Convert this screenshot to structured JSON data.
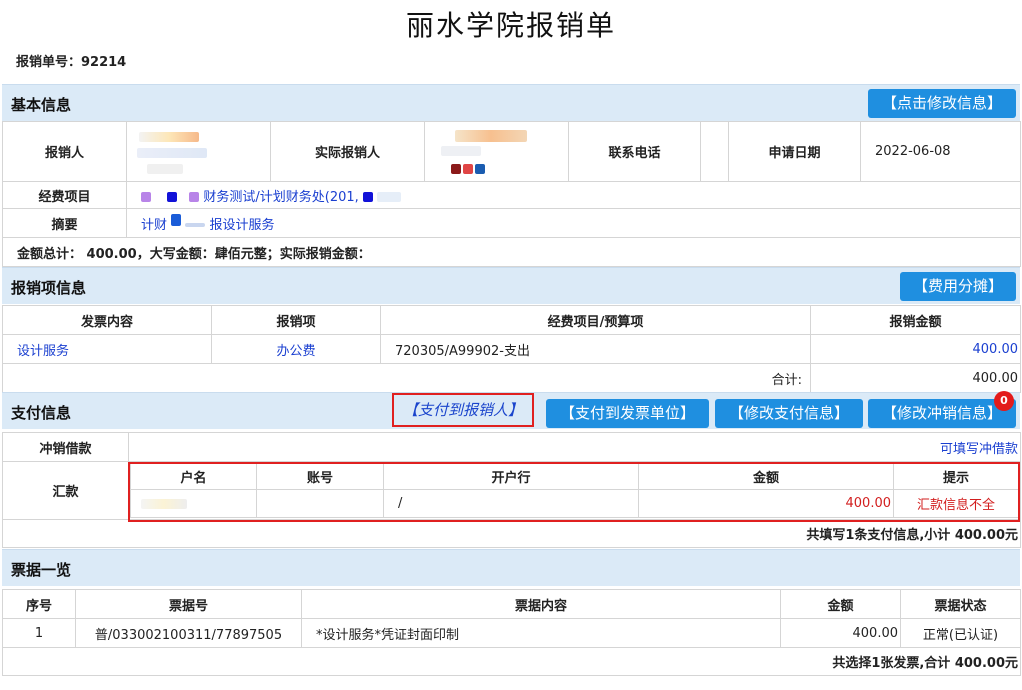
{
  "title": "丽水学院报销单",
  "doc_no": "报销单号：92214",
  "basic": {
    "section_title": "基本信息",
    "edit_button": "【点击修改信息】",
    "applicant_label": "报销人",
    "actual_label": "实际报销人",
    "phone_label": "联系电话",
    "date_label": "申请日期",
    "date_value": "2022-06-08",
    "project_label": "经费项目",
    "project_value": "财务测试/计划财务处(201,",
    "summary_label": "摘要",
    "summary_value_a": "计财",
    "summary_value_b": "报设计服务",
    "total_line": "金额总计： 400.00，大写金额：肆佰元整；实际报销金额："
  },
  "items": {
    "section_title": "报销项信息",
    "split_button": "【费用分摊】",
    "headers": [
      "发票内容",
      "报销项",
      "经费项目/预算项",
      "报销金额"
    ],
    "rows": [
      {
        "content": "设计服务",
        "item": "办公费",
        "budget": "720305/A99902-支出",
        "amount": "400.00"
      }
    ],
    "total_label": "合计:",
    "total_value": "400.00"
  },
  "payment": {
    "section_title": "支付信息",
    "pay_applicant": "【支付到报销人】",
    "pay_invoice_unit": "【支付到发票单位】",
    "edit_payment": "【修改支付信息】",
    "edit_offset": "【修改冲销信息】",
    "badge": "0",
    "offset_label": "冲销借款",
    "offset_link": "可填写冲借款",
    "remit_label": "汇款",
    "headers": [
      "户名",
      "账号",
      "开户行",
      "金额",
      "提示"
    ],
    "rows": [
      {
        "name": "",
        "account": "",
        "bank": "/",
        "amount": "400.00",
        "hint": "汇款信息不全"
      }
    ],
    "summary": "共填写1条支付信息,小计 400.00元"
  },
  "bills": {
    "section_title": "票据一览",
    "headers": [
      "序号",
      "票据号",
      "票据内容",
      "金额",
      "票据状态"
    ],
    "rows": [
      {
        "idx": "1",
        "no": "普/033002100311/77897505",
        "content": "*设计服务*凭证封面印制",
        "amount": "400.00",
        "status": "正常(已认证)"
      }
    ],
    "summary": "共选择1张发票,合计 400.00元"
  }
}
